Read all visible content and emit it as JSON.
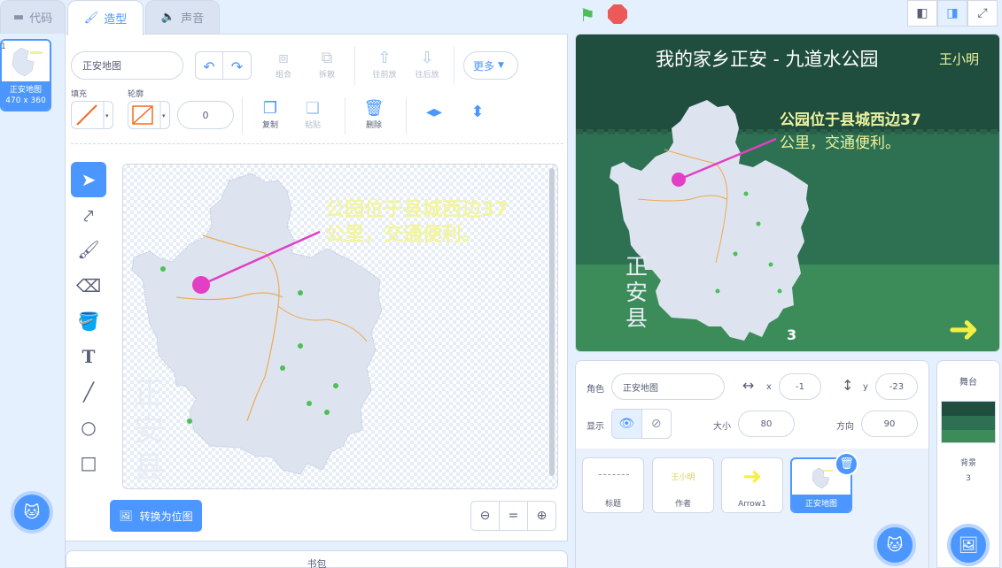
{
  "tabs": [
    {
      "label": "代码",
      "icon": "code-icon"
    },
    {
      "label": "造型",
      "icon": "brush-icon"
    },
    {
      "label": "声音",
      "icon": "speaker-icon"
    }
  ],
  "costume_list": {
    "number": "1",
    "name": "正安地图",
    "size": "470 x 360"
  },
  "editor": {
    "costume_name": "正安地图",
    "group_label": "组合",
    "ungroup_label": "拆散",
    "forward_label": "往前放",
    "backward_label": "往后放",
    "more_label": "更多",
    "fill_label": "填充",
    "outline_label": "轮廓",
    "outline_width": "0",
    "copy_label": "复制",
    "paste_label": "粘贴",
    "delete_label": "删除",
    "convert_label": "转换为位图",
    "zoom_equal": "="
  },
  "canvas_content": {
    "callout_line1": "公园位于县城西边37",
    "callout_line2": "公里，交通便利。",
    "county_text": [
      "正",
      "安",
      "县"
    ]
  },
  "stage": {
    "title": "我的家乡正安 - 九道水公园",
    "author": "王小明",
    "callout_line1": "公园位于县城西边37",
    "callout_line2": "公里，交通便利。",
    "county_text": [
      "正",
      "安",
      "县"
    ],
    "page_num": "3",
    "colors": {
      "band1": "#1f4d3e",
      "band2": "#2e7152",
      "band3": "#3c8c5a",
      "title": "#ffffff",
      "callout": "#ecf2a0"
    }
  },
  "sprite_info": {
    "sprite_label": "角色",
    "sprite_name": "正安地图",
    "x_label": "x",
    "x_value": "-1",
    "y_label": "y",
    "y_value": "-23",
    "show_label": "显示",
    "size_label": "大小",
    "size_value": "80",
    "direction_label": "方向",
    "direction_value": "90"
  },
  "sprites": [
    {
      "name": "标题"
    },
    {
      "name": "作者",
      "preview": "王小明"
    },
    {
      "name": "Arrow1"
    },
    {
      "name": "正安地图"
    }
  ],
  "stage_panel": {
    "title": "舞台",
    "backdrop_label": "背景",
    "backdrop_count": "3"
  },
  "backpack_label": "书包"
}
